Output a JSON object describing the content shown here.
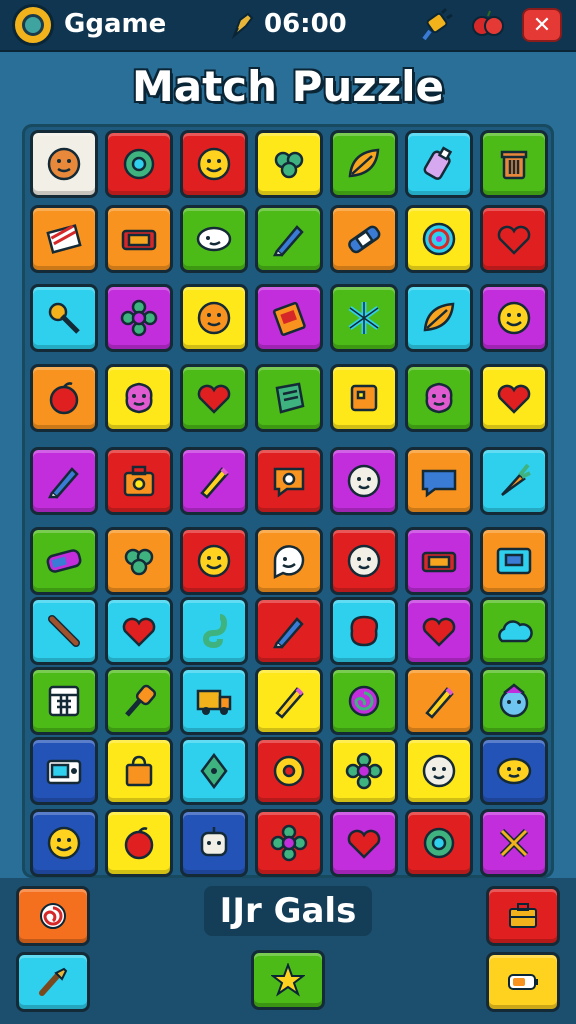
{
  "header": {
    "app_name": "Ggame",
    "timer": "06:00"
  },
  "title": "Match Puzzle",
  "goals_label": "IJr Gals",
  "colors": {
    "R": "#e02020",
    "O": "#f7931e",
    "Y": "#ffe81a",
    "G": "#4cbb17",
    "C": "#2ed0ee",
    "P": "#c22ddc",
    "B": "#2453b8",
    "W": "#f2efe6"
  },
  "grid": [
    [
      {
        "c": "W",
        "i": "cookie-icon"
      },
      {
        "c": "R",
        "i": "gear-icon"
      },
      {
        "c": "R",
        "i": "smiley-icon"
      },
      {
        "c": "Y",
        "i": "clover-icon"
      },
      {
        "c": "G",
        "i": "leaf-icon"
      },
      {
        "c": "C",
        "i": "bottle-icon"
      },
      {
        "c": "G",
        "i": "trash-can-icon"
      }
    ],
    [
      {
        "c": "O",
        "i": "flag-icon"
      },
      {
        "c": "O",
        "i": "ticket-icon"
      },
      {
        "c": "G",
        "i": "bean-icon"
      },
      {
        "c": "G",
        "i": "pen-icon"
      },
      {
        "c": "O",
        "i": "bandage-icon"
      },
      {
        "c": "Y",
        "i": "spiral-bubble-icon"
      },
      {
        "c": "R",
        "i": "heart-icon"
      }
    ],
    [
      {
        "c": "C",
        "i": "wrench-icon"
      },
      {
        "c": "P",
        "i": "flower-icon"
      },
      {
        "c": "Y",
        "i": "cookie-face-icon"
      },
      {
        "c": "P",
        "i": "book-icon"
      },
      {
        "c": "G",
        "i": "sparkle-icon"
      },
      {
        "c": "C",
        "i": "leaf-icon"
      },
      {
        "c": "P",
        "i": "smiley-icon"
      }
    ],
    [
      {
        "c": "O",
        "i": "apple-icon"
      },
      {
        "c": "Y",
        "i": "blob-face-icon"
      },
      {
        "c": "G",
        "i": "heart-icon"
      },
      {
        "c": "G",
        "i": "note-icon"
      },
      {
        "c": "Y",
        "i": "puzzle-icon"
      },
      {
        "c": "G",
        "i": "blob-face-icon"
      },
      {
        "c": "Y",
        "i": "heart-icon"
      }
    ],
    [
      {
        "c": "P",
        "i": "pen-icon"
      },
      {
        "c": "R",
        "i": "suitcase-icon"
      },
      {
        "c": "P",
        "i": "pencil-icon"
      },
      {
        "c": "R",
        "i": "bubble-icon"
      },
      {
        "c": "P",
        "i": "face-icon"
      },
      {
        "c": "O",
        "i": "speech-bubble-icon"
      },
      {
        "c": "C",
        "i": "carrot-icon"
      }
    ],
    [
      {
        "c": "G",
        "i": "soap-icon"
      },
      {
        "c": "O",
        "i": "clover-icon"
      },
      {
        "c": "R",
        "i": "smiley-icon"
      },
      {
        "c": "O",
        "i": "smiley-bubble-icon"
      },
      {
        "c": "R",
        "i": "face-icon"
      },
      {
        "c": "P",
        "i": "ticket-icon"
      },
      {
        "c": "O",
        "i": "tv-icon"
      }
    ],
    [
      {
        "c": "C",
        "i": "stick-icon"
      },
      {
        "c": "C",
        "i": "heart-icon"
      },
      {
        "c": "C",
        "i": "hook-icon"
      },
      {
        "c": "R",
        "i": "pen-icon"
      },
      {
        "c": "C",
        "i": "blob-icon"
      },
      {
        "c": "P",
        "i": "heart-icon"
      },
      {
        "c": "G",
        "i": "cloud-icon"
      }
    ],
    [
      {
        "c": "G",
        "i": "calendar-icon"
      },
      {
        "c": "G",
        "i": "key-icon"
      },
      {
        "c": "C",
        "i": "truck-icon"
      },
      {
        "c": "Y",
        "i": "pencil-icon"
      },
      {
        "c": "G",
        "i": "spiral-icon"
      },
      {
        "c": "O",
        "i": "pencil-icon"
      },
      {
        "c": "G",
        "i": "monster-face-icon"
      }
    ],
    [
      {
        "c": "B",
        "i": "radio-icon"
      },
      {
        "c": "Y",
        "i": "bag-icon"
      },
      {
        "c": "C",
        "i": "nib-icon"
      },
      {
        "c": "R",
        "i": "donut-icon"
      },
      {
        "c": "Y",
        "i": "flower-icon"
      },
      {
        "c": "Y",
        "i": "face-icon"
      },
      {
        "c": "B",
        "i": "lemon-face-icon"
      }
    ],
    [
      {
        "c": "B",
        "i": "smiley-icon"
      },
      {
        "c": "Y",
        "i": "apple-icon"
      },
      {
        "c": "B",
        "i": "robot-face-icon"
      },
      {
        "c": "R",
        "i": "flower-icon"
      },
      {
        "c": "P",
        "i": "heart-icon"
      },
      {
        "c": "R",
        "i": "gear-icon"
      },
      {
        "c": "P",
        "i": "cross-icon"
      }
    ]
  ]
}
